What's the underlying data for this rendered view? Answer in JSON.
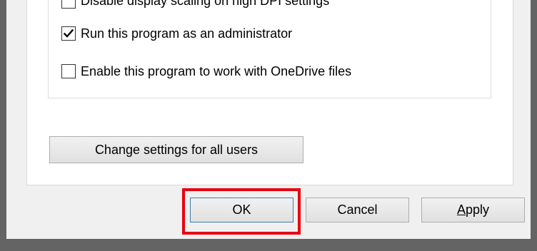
{
  "options": [
    {
      "label": "Disable display scaling on high DPI settings",
      "checked": false
    },
    {
      "label": "Run this program as an administrator",
      "checked": true
    },
    {
      "label": "Enable this program to work with OneDrive files",
      "checked": false
    }
  ],
  "change_settings_label": "Change settings for all users",
  "buttons": {
    "ok_label": "OK",
    "cancel_label": "Cancel",
    "apply_accel": "A",
    "apply_rest": "pply"
  },
  "colors": {
    "highlight": "#e8000e",
    "frame": "#646464"
  }
}
